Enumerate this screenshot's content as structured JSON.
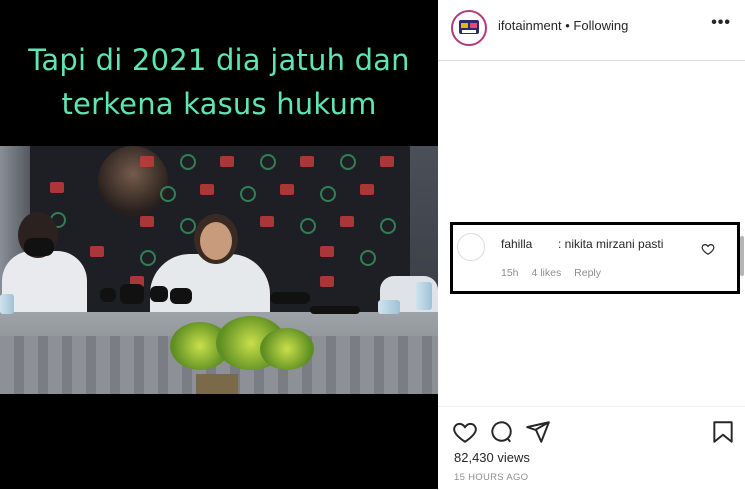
{
  "video": {
    "caption_line1": "Tapi di 2021 dia jatuh dan",
    "caption_line2": "terkena kasus hukum",
    "caption_color": "#5fe5b4"
  },
  "header": {
    "username": "ifotainment",
    "separator": "•",
    "follow_state": "Following",
    "more_label": "•••"
  },
  "comment": {
    "username": "fahilla",
    "text": ": nikita mirzani pasti",
    "time": "15h",
    "likes": "4 likes",
    "reply_label": "Reply",
    "highlight_color": "#000000"
  },
  "footer": {
    "views": "82,430 views",
    "timestamp": "15 HOURS AGO"
  },
  "icons": {
    "like": "heart-icon",
    "comment": "comment-bubble-icon",
    "share": "paper-plane-icon",
    "save": "bookmark-icon",
    "comment_like": "small-heart-icon"
  }
}
